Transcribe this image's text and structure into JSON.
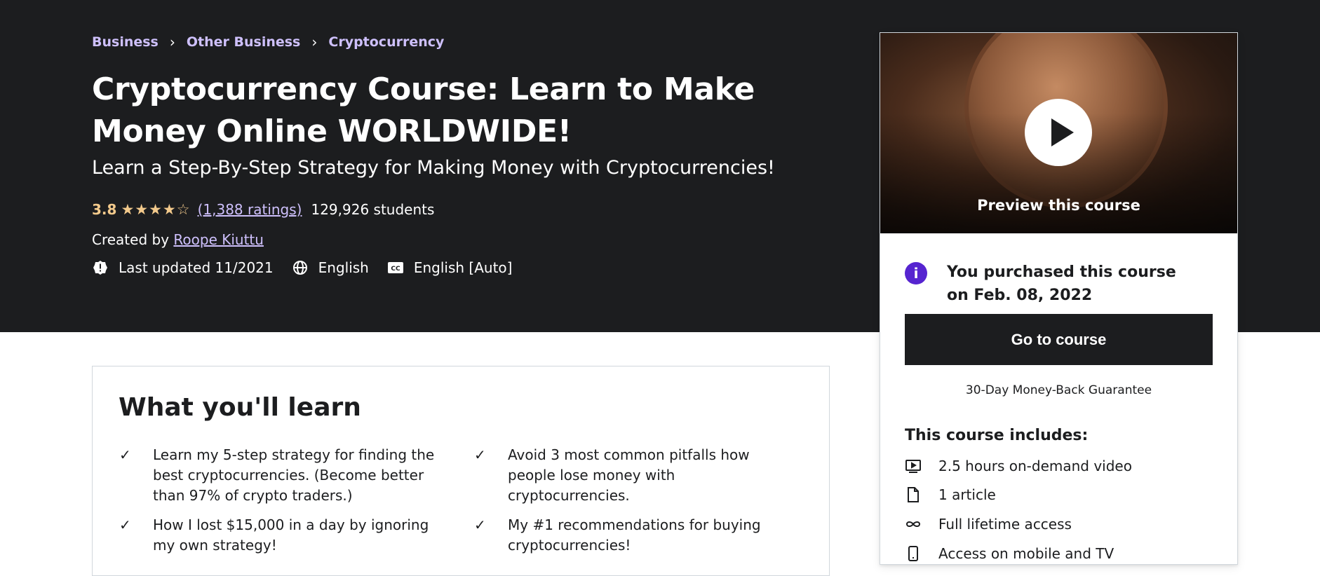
{
  "breadcrumb": [
    "Business",
    "Other Business",
    "Cryptocurrency"
  ],
  "course": {
    "title": "Cryptocurrency Course: Learn to Make Money Online WORLDWIDE!",
    "subtitle": "Learn a Step-By-Step Strategy for Making Money with Cryptocurrencies!",
    "rating": "3.8",
    "stars": "★★★★☆",
    "rating_count": "(1,388 ratings)",
    "students": "129,926 students",
    "created_by_label": "Created by",
    "author": "Roope Kiuttu",
    "last_updated": "Last updated 11/2021",
    "language": "English",
    "captions": "English [Auto]"
  },
  "learn": {
    "title": "What you'll learn",
    "items": [
      "Learn my 5-step strategy for finding the best cryptocurrencies. (Become better than 97% of crypto traders.)",
      "Avoid 3 most common pitfalls how people lose money with cryptocurrencies.",
      "How I lost $15,000 in a day by ignoring my own strategy!",
      "My #1 recommendations for buying cryptocurrencies!"
    ]
  },
  "sidebar": {
    "preview_label": "Preview this course",
    "purchased": "You purchased this course on Feb. 08, 2022",
    "go_to_course": "Go to course",
    "guarantee": "30-Day Money-Back Guarantee",
    "includes_title": "This course includes:",
    "includes": [
      {
        "icon": "video-icon",
        "label": "2.5 hours on-demand video"
      },
      {
        "icon": "article-icon",
        "label": "1 article"
      },
      {
        "icon": "infinity-icon",
        "label": "Full lifetime access"
      },
      {
        "icon": "mobile-icon",
        "label": "Access on mobile and TV"
      }
    ]
  },
  "colors": {
    "hero_bg": "#1c1d1f",
    "link": "#cec0fc",
    "star": "#f3ca8c",
    "accent": "#5624d0"
  }
}
